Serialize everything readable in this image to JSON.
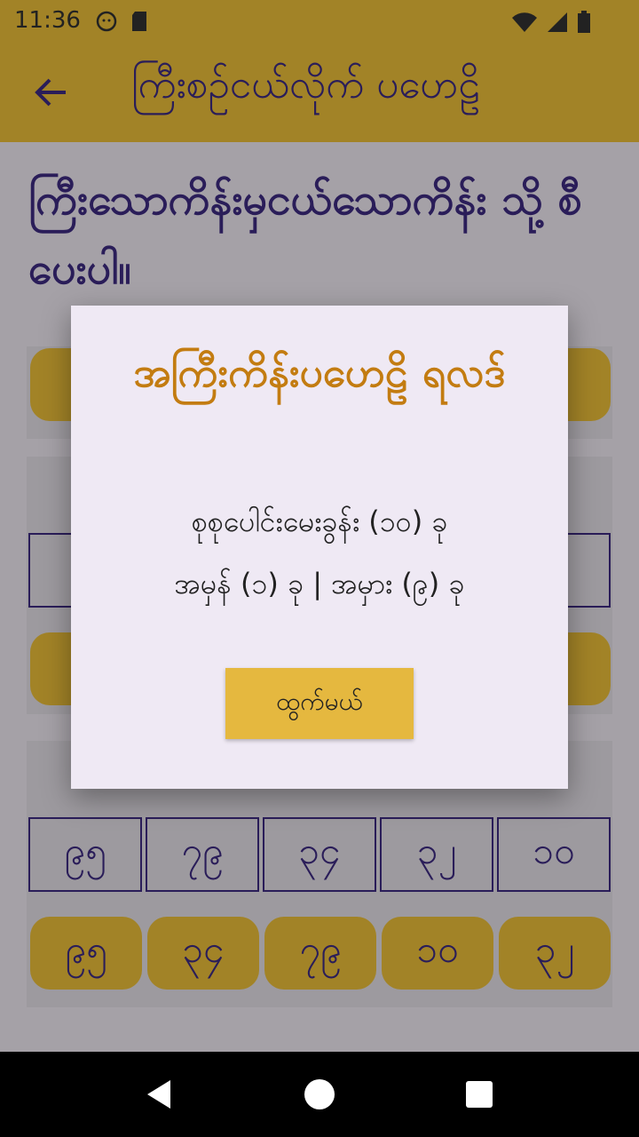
{
  "status": {
    "time": "11:36"
  },
  "appbar": {
    "title": "ကြီးစဉ်ငယ်လိုက် ပဟေဠိ"
  },
  "question": {
    "text": "ကြီးသောကိန်းမှငယ်သောကိန်း သို့ စီပေးပါ။"
  },
  "bottom": {
    "cells": [
      "၉၅",
      "၇၉",
      "၃၄",
      "၃၂",
      "၁၀"
    ],
    "chips": [
      "၉၅",
      "၃၄",
      "၇၉",
      "၁၀",
      "၃၂"
    ]
  },
  "dialog": {
    "title": "အကြီးကိန်းပဟေဠိ ရလဒ်",
    "total": "စုစုပေါင်းမေးခွန်း (၁၀) ခု",
    "score": "အမှန် (၁) ခု | အမှား (၉) ခု",
    "exit_label": "ထွက်မယ်"
  },
  "colors": {
    "primary": "#3e2b83",
    "accent": "#efc23a",
    "result_title": "#c37c11"
  }
}
